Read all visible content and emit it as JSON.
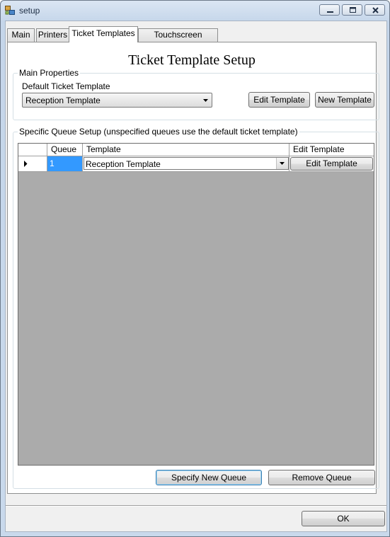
{
  "window": {
    "title": "setup",
    "icon": "app-window-icon"
  },
  "tabs": [
    {
      "label": "Main"
    },
    {
      "label": "Printers"
    },
    {
      "label": "Ticket Templates"
    },
    {
      "label": "Touchscreen Settings"
    }
  ],
  "page": {
    "title": "Ticket Template Setup",
    "main_group": {
      "legend": "Main Properties",
      "default_label": "Default Ticket Template",
      "default_value": "Reception Template",
      "edit_button": "Edit Template",
      "new_button": "New Template"
    },
    "queue_group": {
      "legend": "Specific Queue Setup (unspecified queues use the default ticket template)",
      "columns": [
        "Queue",
        "Template",
        "Edit Template"
      ],
      "rows": [
        {
          "queue": "1",
          "template": "Reception Template",
          "edit": "Edit Template"
        }
      ],
      "specify_button": "Specify New Queue",
      "remove_button": "Remove Queue"
    }
  },
  "footer": {
    "ok_button": "OK"
  }
}
